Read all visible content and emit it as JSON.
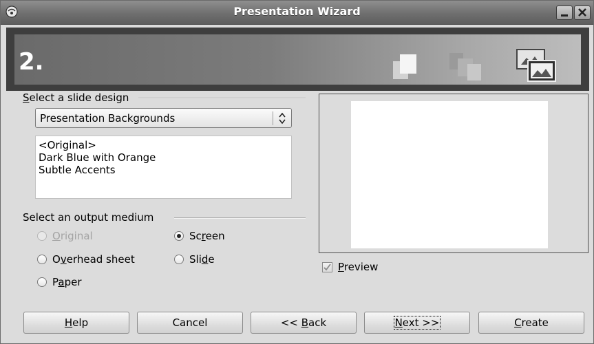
{
  "window": {
    "title": "Presentation Wizard",
    "icons": [
      "app-icon",
      "minimize-icon",
      "close-icon"
    ]
  },
  "header": {
    "step": "2.",
    "icons": [
      "single-slide-icon",
      "stacked-slides-icon",
      "picture-slides-icon"
    ]
  },
  "slide_design": {
    "label_prefix": "",
    "label_mnemonic": "S",
    "label_rest": "elect a slide design",
    "dropdown_value": "Presentation Backgrounds",
    "items": [
      "<Original>",
      "Dark Blue with Orange",
      "Subtle Accents"
    ]
  },
  "output_medium": {
    "label": "Select an output medium",
    "options": [
      {
        "pre": "",
        "mn": "O",
        "post": "riginal",
        "checked": false,
        "disabled": true
      },
      {
        "pre": "Sc",
        "mn": "r",
        "post": "een",
        "checked": true,
        "disabled": false
      },
      {
        "pre": "O",
        "mn": "v",
        "post": "erhead sheet",
        "checked": false,
        "disabled": false
      },
      {
        "pre": "Sli",
        "mn": "d",
        "post": "e",
        "checked": false,
        "disabled": false
      },
      {
        "pre": "P",
        "mn": "a",
        "post": "per",
        "checked": false,
        "disabled": false
      }
    ]
  },
  "preview": {
    "checkbox_pre": "",
    "checkbox_mn": "P",
    "checkbox_post": "review",
    "checked": true
  },
  "buttons": {
    "help": {
      "pre": "",
      "mn": "H",
      "post": "elp"
    },
    "cancel": {
      "text": "Cancel"
    },
    "back": {
      "pre": "<< ",
      "mn": "B",
      "post": "ack"
    },
    "next": {
      "pre": "",
      "mn": "N",
      "post": "ext >>"
    },
    "create": {
      "pre": "",
      "mn": "C",
      "post": "reate"
    }
  }
}
